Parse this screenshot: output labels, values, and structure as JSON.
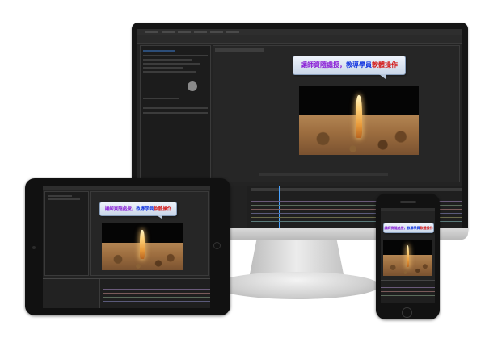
{
  "caption_zh": {
    "part1": "讓師資隨處授，",
    "part2": "教導學員",
    "part3": "軟體操作"
  },
  "colors": {
    "purple": "#8a1fd6",
    "blue": "#1a3be0",
    "red": "#d41a1a",
    "ui_background": "#232323",
    "playhead": "#4aa3ff"
  },
  "devices": [
    "monitor",
    "tablet",
    "phone"
  ],
  "editor": {
    "preview": "desert-flame-video-frame"
  }
}
